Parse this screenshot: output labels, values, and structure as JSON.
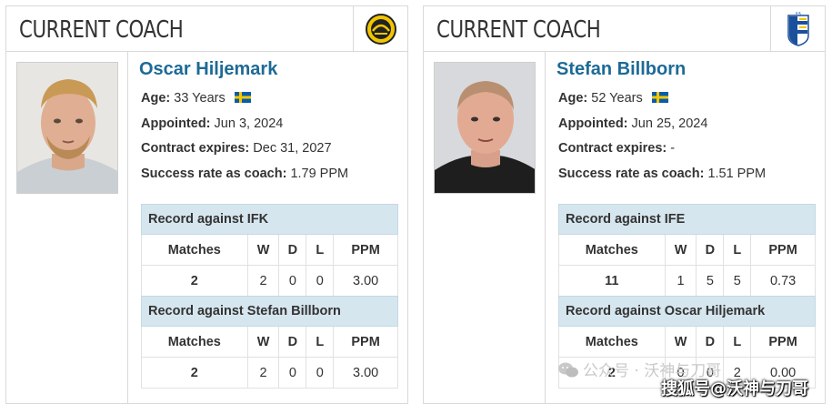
{
  "cards": [
    {
      "header_title": "CURRENT COACH",
      "club_logo_icon": "elfsborg-crest-icon",
      "coach": {
        "name": "Oscar Hiljemark",
        "age_label": "Age:",
        "age_value": "33 Years",
        "appointed_label": "Appointed:",
        "appointed_value": "Jun 3, 2024",
        "contract_label": "Contract expires:",
        "contract_value": "Dec 31, 2027",
        "success_label": "Success rate as coach:",
        "success_value": "1.79 PPM",
        "nationality_icon": "sweden-flag-icon"
      },
      "record_club": {
        "title": "Record against IFK",
        "headers": [
          "Matches",
          "W",
          "D",
          "L",
          "PPM"
        ],
        "row": {
          "matches": "2",
          "w": "2",
          "d": "0",
          "l": "0",
          "ppm": "3.00"
        }
      },
      "record_coach": {
        "title": "Record against Stefan Billborn",
        "headers": [
          "Matches",
          "W",
          "D",
          "L",
          "PPM"
        ],
        "row": {
          "matches": "2",
          "w": "2",
          "d": "0",
          "l": "0",
          "ppm": "3.00"
        }
      }
    },
    {
      "header_title": "CURRENT COACH",
      "club_logo_icon": "ifk-goteborg-crest-icon",
      "coach": {
        "name": "Stefan Billborn",
        "age_label": "Age:",
        "age_value": "52 Years",
        "appointed_label": "Appointed:",
        "appointed_value": "Jun 25, 2024",
        "contract_label": "Contract expires:",
        "contract_value": "-",
        "success_label": "Success rate as coach:",
        "success_value": "1.51 PPM",
        "nationality_icon": "sweden-flag-icon"
      },
      "record_club": {
        "title": "Record against IFE",
        "headers": [
          "Matches",
          "W",
          "D",
          "L",
          "PPM"
        ],
        "row": {
          "matches": "11",
          "w": "1",
          "d": "5",
          "l": "5",
          "ppm": "0.73"
        }
      },
      "record_coach": {
        "title": "Record against Oscar Hiljemark",
        "headers": [
          "Matches",
          "W",
          "D",
          "L",
          "PPM"
        ],
        "row": {
          "matches": "2",
          "w": "0",
          "d": "0",
          "l": "2",
          "ppm": "0.00"
        }
      }
    }
  ],
  "watermark": {
    "line1": "公众号 · 沃神与刀哥",
    "line2": "搜狐号@沃神与刀哥"
  },
  "colors": {
    "accent_blue": "#1d6a96",
    "section_head_bg": "#d6e6ef",
    "border": "#d9d9d9"
  }
}
